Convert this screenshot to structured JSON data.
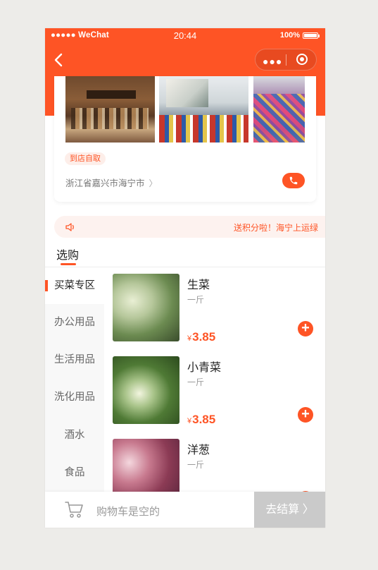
{
  "status_bar": {
    "carrier": "●●●●● WeChat",
    "time": "20:44",
    "battery": "100%"
  },
  "nav": {
    "icons": [
      "back-arrow-icon",
      "more-dots-icon",
      "close-target-icon"
    ]
  },
  "store": {
    "pickup_tag": "到店自取",
    "address": "浙江省嘉兴市海宁市",
    "address_chevron": "〉"
  },
  "notice": {
    "text": "送积分啦！海宁上运绿"
  },
  "tab": {
    "label": "选购"
  },
  "categories": [
    {
      "label": "买菜专区",
      "active": true
    },
    {
      "label": "办公用品",
      "active": false
    },
    {
      "label": "生活用品",
      "active": false
    },
    {
      "label": "洗化用品",
      "active": false
    },
    {
      "label": "酒水",
      "active": false
    },
    {
      "label": "食品",
      "active": false
    }
  ],
  "products": [
    {
      "name": "生菜",
      "spec": "一斤",
      "currency": "¥",
      "price": "3.85",
      "add": "+"
    },
    {
      "name": "小青菜",
      "spec": "一斤",
      "currency": "¥",
      "price": "3.85",
      "add": "+"
    },
    {
      "name": "洋葱",
      "spec": "一斤",
      "currency": "¥",
      "price": "",
      "add": "+"
    }
  ],
  "cart": {
    "empty_text": "购物车是空的",
    "checkout_label": "去结算 〉"
  },
  "colors": {
    "accent": "#fe5425",
    "checkout_disabled": "#cacaca"
  }
}
